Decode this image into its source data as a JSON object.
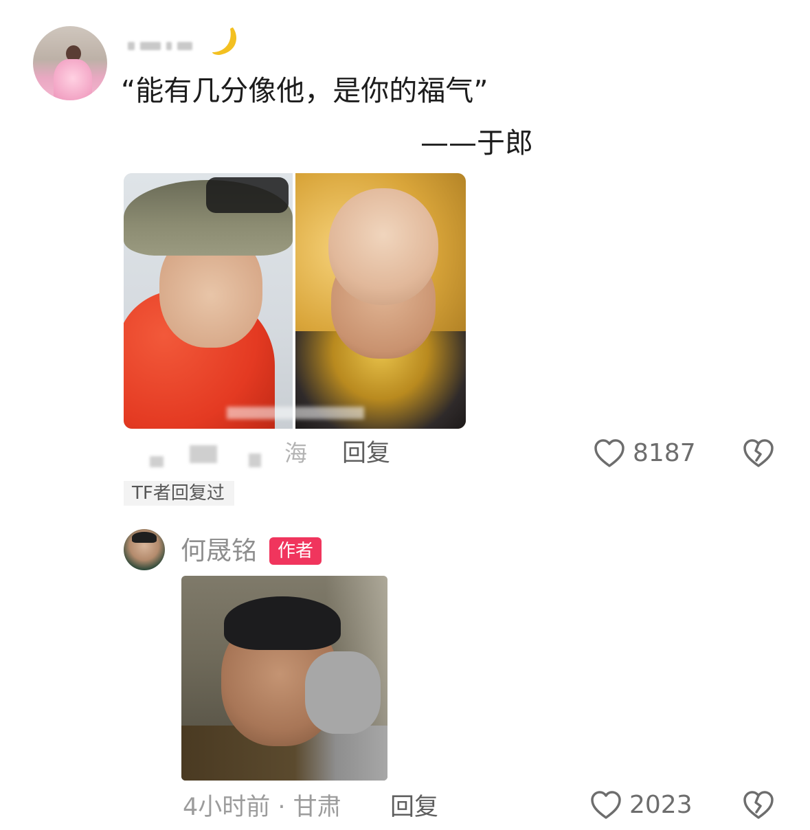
{
  "comment": {
    "quote": "“能有几分像他，是你的福气”",
    "signature": "——于郎",
    "location_fragment": "海",
    "reply_label": "回复",
    "like_count": "8187",
    "author_replied_label": "TF者回复过"
  },
  "reply": {
    "username": "何晟铭",
    "badge": "作者",
    "time_location": "4小时前 · 甘肃",
    "reply_label": "回复",
    "like_count": "2023"
  },
  "colors": {
    "badge_bg": "#f0355d",
    "secondary_text": "#8e8e8e",
    "icon_gray": "#6d6d6d"
  },
  "icons": [
    "moon-icon",
    "heart-icon",
    "broken-heart-icon"
  ]
}
